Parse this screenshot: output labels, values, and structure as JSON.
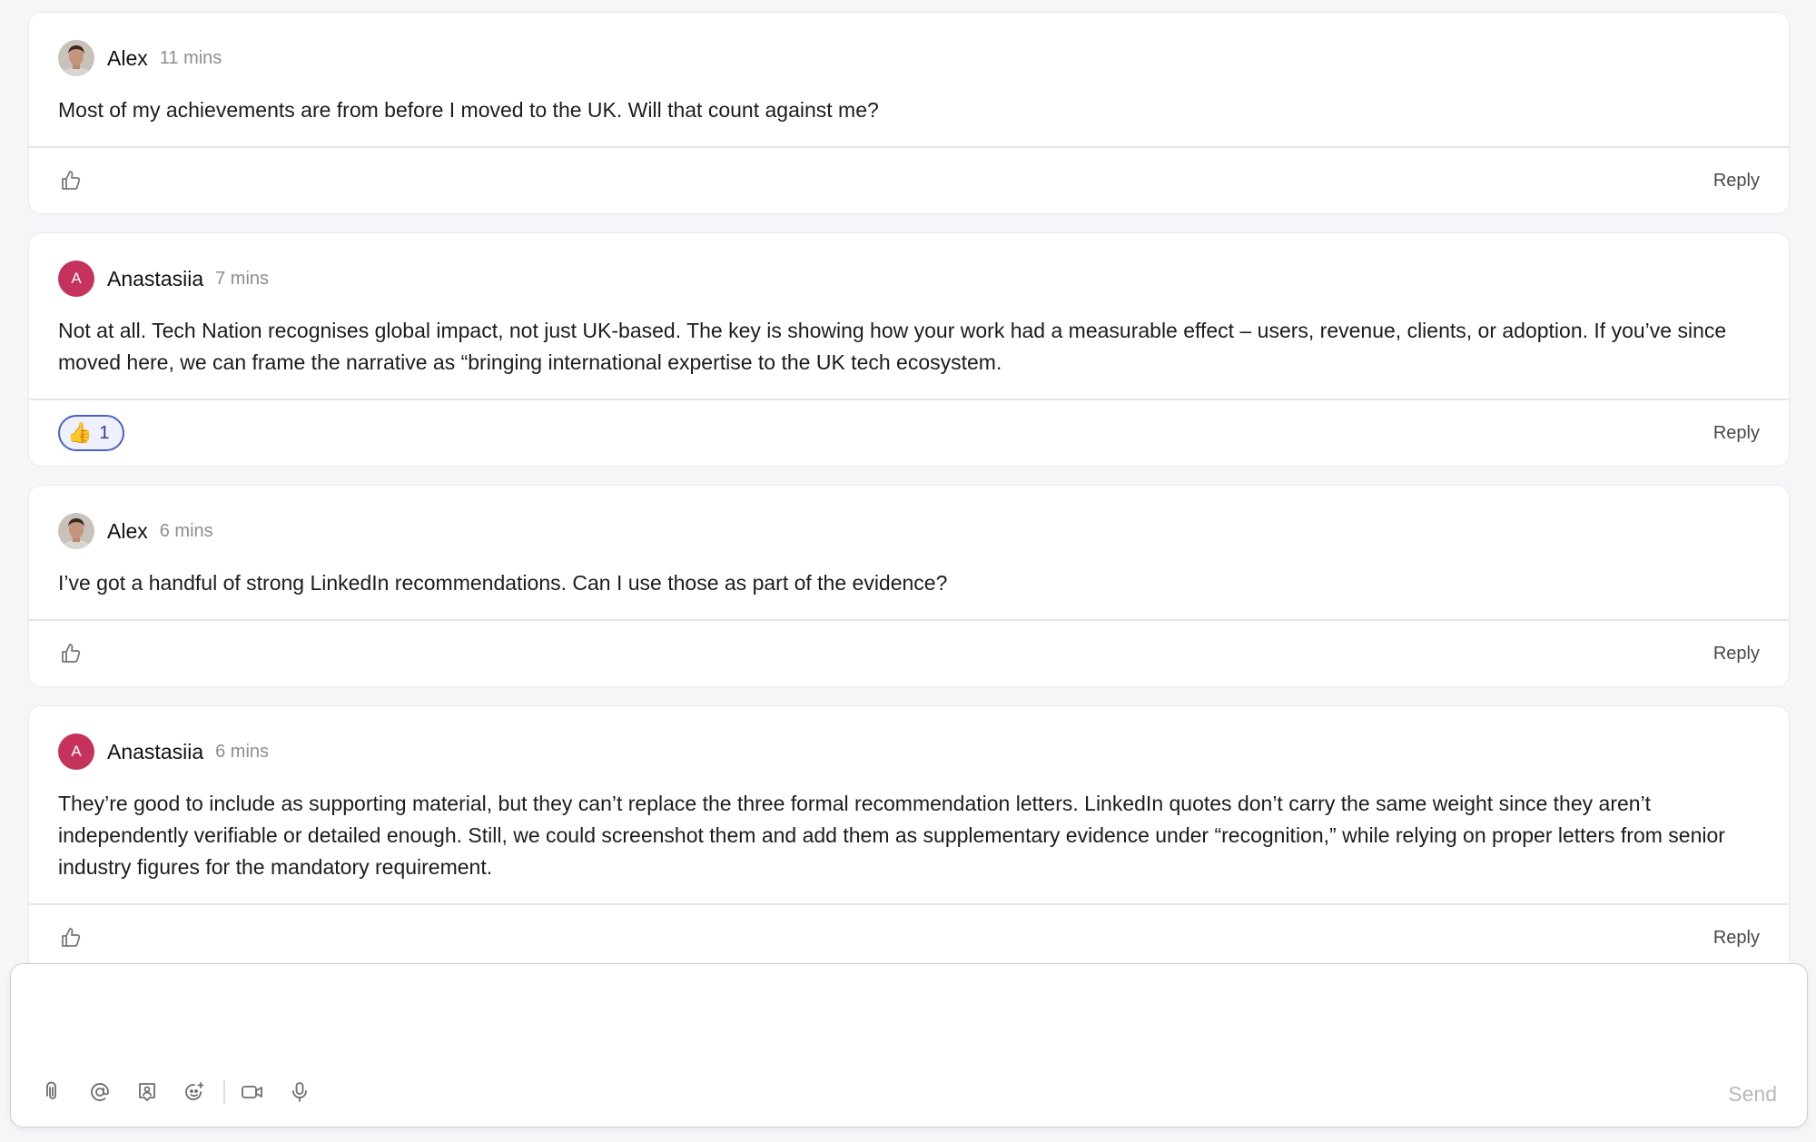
{
  "comments": [
    {
      "author": "Alex",
      "avatar_type": "photo",
      "time": "11 mins",
      "text": "Most of my achievements are from before I moved to the UK. Will that count against me?",
      "reply_label": "Reply"
    },
    {
      "author": "Anastasiia",
      "avatar_type": "letter",
      "avatar_letter": "A",
      "avatar_color": "#c5325b",
      "time": "7 mins",
      "text": "Not at all. Tech Nation recognises global impact, not just UK-based. The key is showing how your work had a measurable effect – users, revenue, clients, or adoption. If you’ve since moved here, we can frame the narrative as “bringing international expertise to the UK tech ecosystem.",
      "reaction": {
        "emoji": "👍",
        "count": "1"
      },
      "reply_label": "Reply"
    },
    {
      "author": "Alex",
      "avatar_type": "photo",
      "time": "6 mins",
      "text": "I’ve got a handful of strong LinkedIn recommendations. Can I use those as part of the evidence?",
      "reply_label": "Reply"
    },
    {
      "author": "Anastasiia",
      "avatar_type": "letter",
      "avatar_letter": "A",
      "avatar_color": "#c5325b",
      "time": "6 mins",
      "text": "They’re good to include as supporting material, but they can’t replace the three formal recommendation letters. LinkedIn quotes don’t carry the same weight since they aren’t independently verifiable or detailed enough. Still, we could screenshot them and add them as supplementary evidence under “recognition,” while relying on proper letters from senior industry figures for the mandatory requirement.",
      "reply_label": "Reply"
    }
  ],
  "composer": {
    "value": "",
    "send_label": "Send",
    "tools": [
      "paperclip-icon",
      "at-sign-icon",
      "person-tag-icon",
      "emoji-add-icon",
      "video-icon",
      "microphone-icon"
    ]
  },
  "colors": {
    "accent": "#4a62c4",
    "avatar_letter_bg": "#c5325b",
    "muted_text": "#8e8d93"
  }
}
